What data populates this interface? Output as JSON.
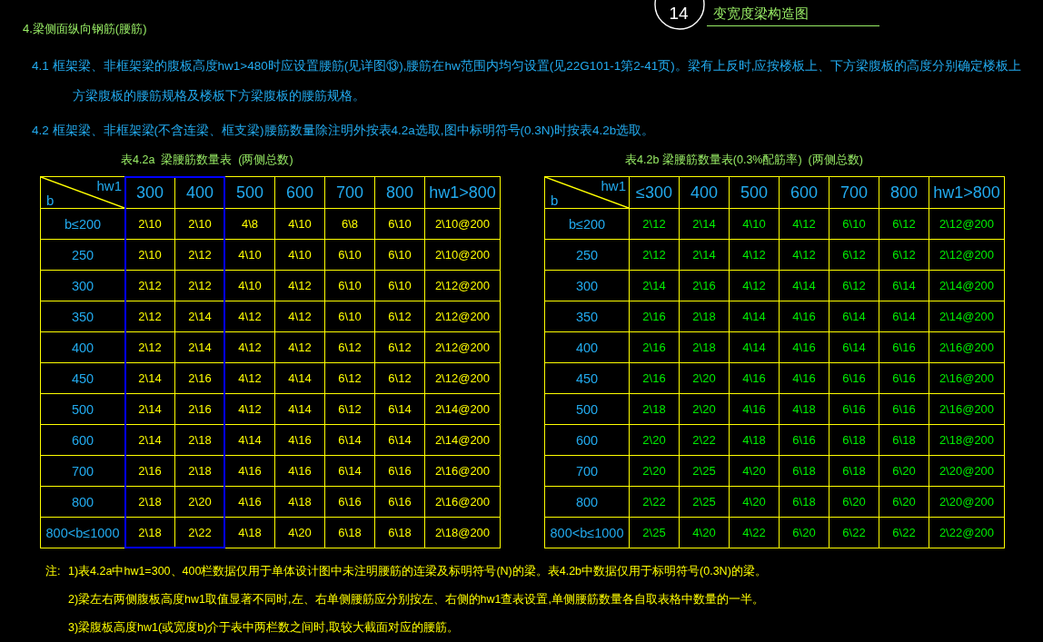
{
  "section_heading": "4.梁侧面纵向钢筋(腰筋)",
  "detail": {
    "number": "14",
    "title": "变宽度梁构造图"
  },
  "paragraphs": [
    "4.1 框架梁、非框架梁的腹板高度hw1>480时应设置腰筋(见详图⑬),腰筋在hw范围内均匀设置(见22G101-1第2-41页)。梁有上反时,应按楼板上、下方梁腹板的高度分别确定楼板上方梁腹板的腰筋规格及楼板下方梁腹板的腰筋规格。",
    "4.2 框架梁、非框架梁(不含连梁、框支梁)腰筋数量除注明外按表4.2a选取,图中标明符号(0.3N)时按表4.2b选取。"
  ],
  "tables": [
    {
      "title": "表4.2a  梁腰筋数量表  (两侧总数)",
      "corner": {
        "column_label": "hw1",
        "row_label": "b"
      },
      "color": "#ffff00",
      "columns": [
        {
          "label": "300",
          "highlighted": true
        },
        {
          "label": "400",
          "highlighted": true
        },
        {
          "label": "500",
          "highlighted": false
        },
        {
          "label": "600",
          "highlighted": false
        },
        {
          "label": "700",
          "highlighted": false
        },
        {
          "label": "800",
          "highlighted": false
        },
        {
          "label": "hw1>800",
          "highlighted": false
        }
      ],
      "rows": [
        {
          "label": "b≤200",
          "values": [
            "2\\10",
            "2\\10",
            "4\\8",
            "4\\10",
            "6\\8",
            "6\\10",
            "2\\10@200"
          ]
        },
        {
          "label": "250",
          "values": [
            "2\\10",
            "2\\12",
            "4\\10",
            "4\\10",
            "6\\10",
            "6\\10",
            "2\\10@200"
          ]
        },
        {
          "label": "300",
          "values": [
            "2\\12",
            "2\\12",
            "4\\10",
            "4\\12",
            "6\\10",
            "6\\10",
            "2\\12@200"
          ]
        },
        {
          "label": "350",
          "values": [
            "2\\12",
            "2\\14",
            "4\\12",
            "4\\12",
            "6\\10",
            "6\\12",
            "2\\12@200"
          ]
        },
        {
          "label": "400",
          "values": [
            "2\\12",
            "2\\14",
            "4\\12",
            "4\\12",
            "6\\12",
            "6\\12",
            "2\\12@200"
          ]
        },
        {
          "label": "450",
          "values": [
            "2\\14",
            "2\\16",
            "4\\12",
            "4\\14",
            "6\\12",
            "6\\12",
            "2\\12@200"
          ]
        },
        {
          "label": "500",
          "values": [
            "2\\14",
            "2\\16",
            "4\\12",
            "4\\14",
            "6\\12",
            "6\\14",
            "2\\14@200"
          ]
        },
        {
          "label": "600",
          "values": [
            "2\\14",
            "2\\18",
            "4\\14",
            "4\\16",
            "6\\14",
            "6\\14",
            "2\\14@200"
          ]
        },
        {
          "label": "700",
          "values": [
            "2\\16",
            "2\\18",
            "4\\16",
            "4\\16",
            "6\\14",
            "6\\16",
            "2\\16@200"
          ]
        },
        {
          "label": "800",
          "values": [
            "2\\18",
            "2\\20",
            "4\\16",
            "4\\18",
            "6\\16",
            "6\\16",
            "2\\16@200"
          ]
        },
        {
          "label": "800<b≤1000",
          "values": [
            "2\\18",
            "2\\22",
            "4\\18",
            "4\\20",
            "6\\18",
            "6\\18",
            "2\\18@200"
          ]
        }
      ]
    },
    {
      "title": "表4.2b 梁腰筋数量表(0.3%配筋率)  (两侧总数)",
      "corner": {
        "column_label": "hw1",
        "row_label": "b"
      },
      "color": "#00ee00",
      "columns": [
        {
          "label": "≤300"
        },
        {
          "label": "400"
        },
        {
          "label": "500"
        },
        {
          "label": "600"
        },
        {
          "label": "700"
        },
        {
          "label": "800"
        },
        {
          "label": "hw1>800"
        }
      ],
      "rows": [
        {
          "label": "b≤200",
          "values": [
            "2\\12",
            "2\\14",
            "4\\10",
            "4\\12",
            "6\\10",
            "6\\12",
            "2\\12@200"
          ]
        },
        {
          "label": "250",
          "values": [
            "2\\12",
            "2\\14",
            "4\\12",
            "4\\12",
            "6\\12",
            "6\\12",
            "2\\12@200"
          ]
        },
        {
          "label": "300",
          "values": [
            "2\\14",
            "2\\16",
            "4\\12",
            "4\\14",
            "6\\12",
            "6\\14",
            "2\\14@200"
          ]
        },
        {
          "label": "350",
          "values": [
            "2\\16",
            "2\\18",
            "4\\14",
            "4\\16",
            "6\\14",
            "6\\14",
            "2\\14@200"
          ]
        },
        {
          "label": "400",
          "values": [
            "2\\16",
            "2\\18",
            "4\\14",
            "4\\16",
            "6\\14",
            "6\\16",
            "2\\16@200"
          ]
        },
        {
          "label": "450",
          "values": [
            "2\\16",
            "2\\20",
            "4\\16",
            "4\\16",
            "6\\16",
            "6\\16",
            "2\\16@200"
          ]
        },
        {
          "label": "500",
          "values": [
            "2\\18",
            "2\\20",
            "4\\16",
            "4\\18",
            "6\\16",
            "6\\16",
            "2\\16@200"
          ]
        },
        {
          "label": "600",
          "values": [
            "2\\20",
            "2\\22",
            "4\\18",
            "6\\16",
            "6\\18",
            "6\\18",
            "2\\18@200"
          ]
        },
        {
          "label": "700",
          "values": [
            "2\\20",
            "2\\25",
            "4\\20",
            "6\\18",
            "6\\18",
            "6\\20",
            "2\\20@200"
          ]
        },
        {
          "label": "800",
          "values": [
            "2\\22",
            "2\\25",
            "4\\20",
            "6\\18",
            "6\\20",
            "6\\20",
            "2\\20@200"
          ]
        },
        {
          "label": "800<b≤1000",
          "values": [
            "2\\25",
            "4\\20",
            "4\\22",
            "6\\20",
            "6\\22",
            "6\\22",
            "2\\22@200"
          ]
        }
      ]
    }
  ],
  "notes": {
    "label": "注:",
    "items": [
      "1)表4.2a中hw1=300、400栏数据仅用于单体设计图中未注明腰筋的连梁及标明符号(N)的梁。表4.2b中数据仅用于标明符号(0.3N)的梁。",
      "2)梁左右两侧腹板高度hw1取值显著不同时,左、右单侧腰筋应分别按左、右侧的hw1查表设置,单侧腰筋数量各自取表格中数量的一半。",
      "3)梁腹板高度hw1(或宽度b)介于表中两栏数之间时,取较大截面对应的腰筋。"
    ]
  }
}
